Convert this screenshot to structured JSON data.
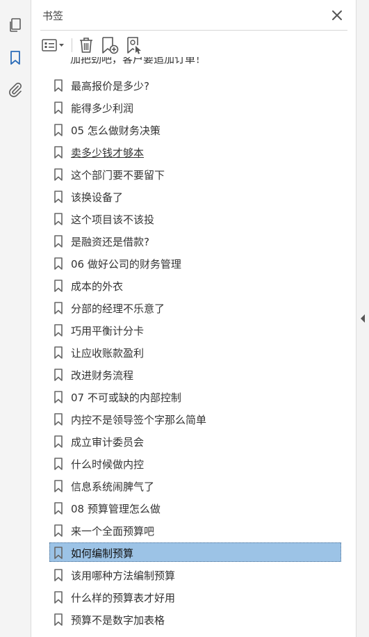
{
  "panel": {
    "title": "书签"
  },
  "rail": {
    "icons": [
      "pages-icon",
      "bookmark-icon",
      "attachment-icon"
    ]
  },
  "toolbar": {
    "icons": [
      "options-menu-icon",
      "delete-bookmark-icon",
      "add-bookmark-icon",
      "new-bookmark-from-structure-icon"
    ]
  },
  "bookmarks": {
    "cut_off_item": "加把劲吧，客户要追加订单！",
    "items": [
      "最高报价是多少?",
      "能得多少利润",
      "05 怎么做财务决策",
      "卖多少钱才够本",
      "这个部门要不要留下",
      "该换设备了",
      "这个项目该不该投",
      "是融资还是借款?",
      "06 做好公司的财务管理",
      "成本的外衣",
      "分部的经理不乐意了",
      "巧用平衡计分卡",
      "让应收账款盈利",
      "改进财务流程",
      "07 不可或缺的内部控制",
      "内控不是领导签个字那么简单",
      "成立审计委员会",
      "什么时候做内控",
      "信息系统闹脾气了",
      "08 预算管理怎么做",
      "来一个全面预算吧",
      "如何编制预算",
      "该用哪种方法编制预算",
      "什么样的预算表才好用",
      "预算不是数字加表格"
    ],
    "selected": "如何编制预算",
    "hovered": "卖多少钱才够本"
  },
  "colors": {
    "selection": "#9cc3e6",
    "accent": "#2b6cb8"
  }
}
